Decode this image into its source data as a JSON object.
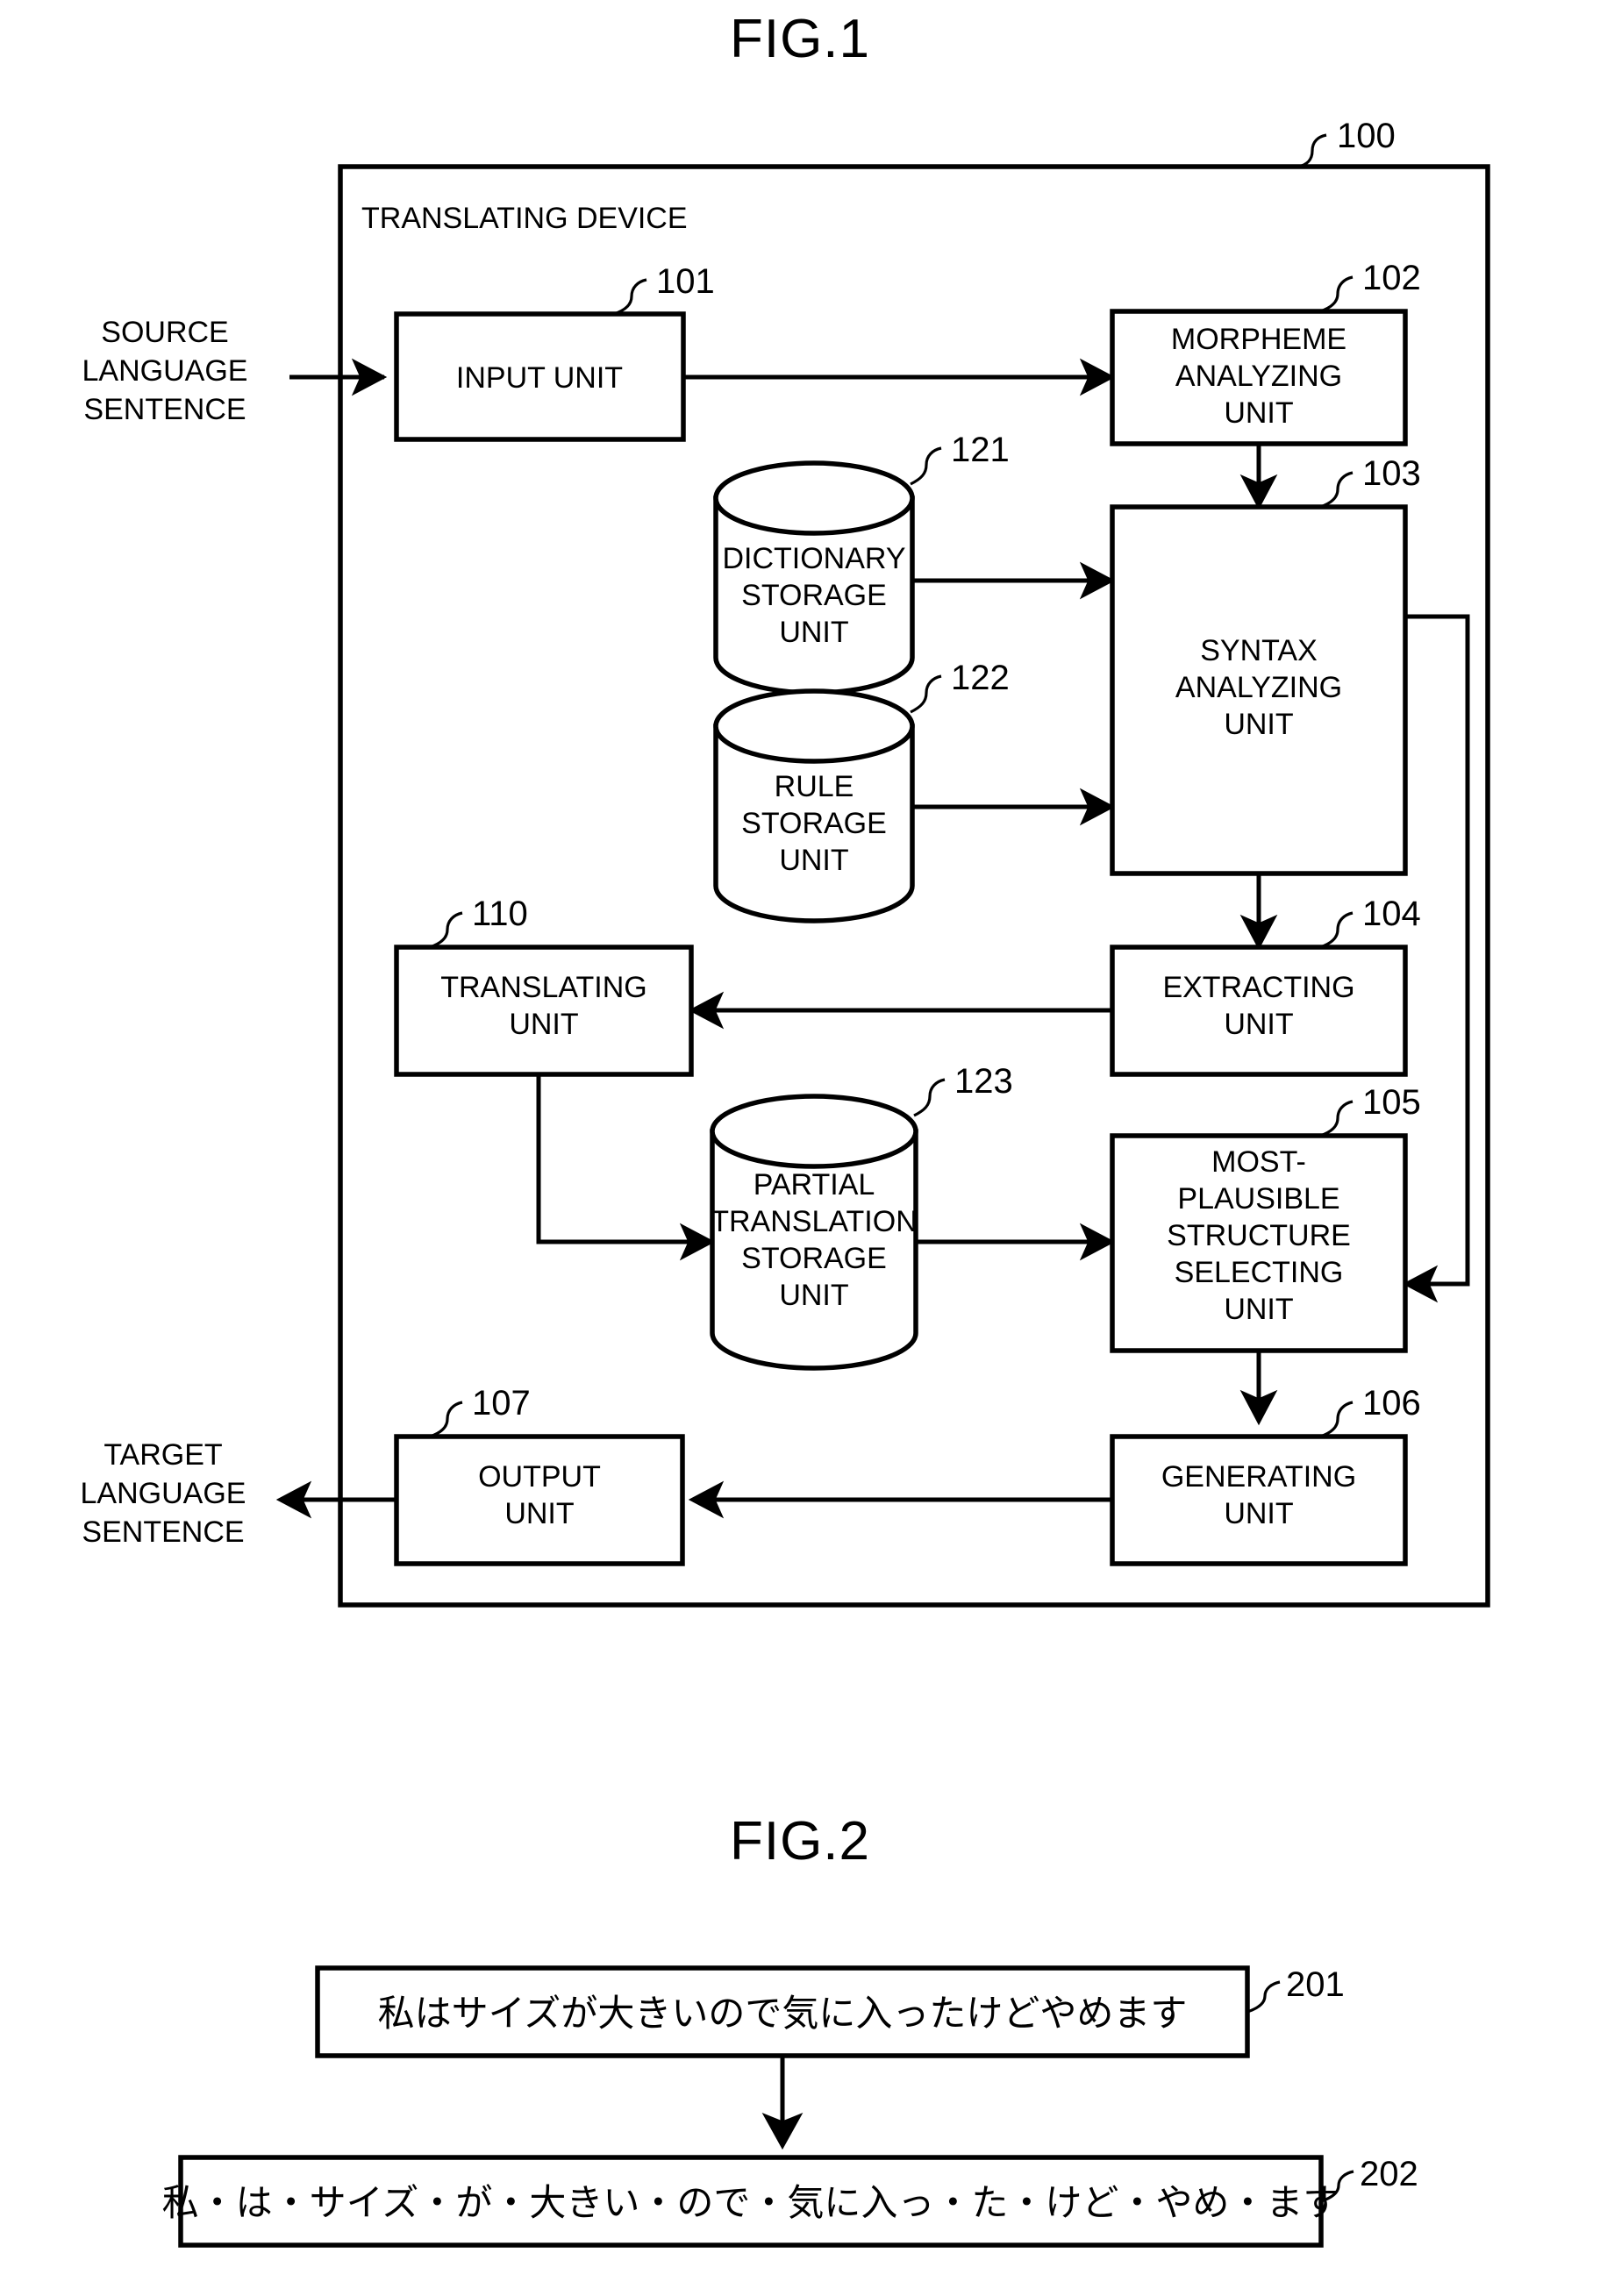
{
  "figures": [
    {
      "id": "fig1",
      "title": "FIG.1",
      "device": {
        "label": "TRANSLATING DEVICE",
        "ref": "100"
      },
      "external_labels": {
        "source": [
          "SOURCE",
          "LANGUAGE",
          "SENTENCE"
        ],
        "target": [
          "TARGET",
          "LANGUAGE",
          "SENTENCE"
        ]
      },
      "blocks": [
        {
          "name": "input-unit",
          "ref": "101",
          "lines": [
            "INPUT UNIT"
          ]
        },
        {
          "name": "morpheme-analyzing-unit",
          "ref": "102",
          "lines": [
            "MORPHEME",
            "ANALYZING",
            "UNIT"
          ]
        },
        {
          "name": "syntax-analyzing-unit",
          "ref": "103",
          "lines": [
            "SYNTAX",
            "ANALYZING",
            "UNIT"
          ]
        },
        {
          "name": "extracting-unit",
          "ref": "104",
          "lines": [
            "EXTRACTING",
            "UNIT"
          ]
        },
        {
          "name": "most-plausible-structure-selecting-unit",
          "ref": "105",
          "lines": [
            "MOST-",
            "PLAUSIBLE",
            "STRUCTURE",
            "SELECTING",
            "UNIT"
          ]
        },
        {
          "name": "generating-unit",
          "ref": "106",
          "lines": [
            "GENERATING",
            "UNIT"
          ]
        },
        {
          "name": "output-unit",
          "ref": "107",
          "lines": [
            "OUTPUT",
            "UNIT"
          ]
        },
        {
          "name": "translating-unit",
          "ref": "110",
          "lines": [
            "TRANSLATING",
            "UNIT"
          ]
        }
      ],
      "storages": [
        {
          "name": "dictionary-storage-unit",
          "ref": "121",
          "lines": [
            "DICTIONARY",
            "STORAGE",
            "UNIT"
          ]
        },
        {
          "name": "rule-storage-unit",
          "ref": "122",
          "lines": [
            "RULE",
            "STORAGE",
            "UNIT"
          ]
        },
        {
          "name": "partial-translation-storage-unit",
          "ref": "123",
          "lines": [
            "PARTIAL",
            "TRANSLATION",
            "STORAGE",
            "UNIT"
          ]
        }
      ]
    },
    {
      "id": "fig2",
      "title": "FIG.2",
      "boxes": [
        {
          "name": "source-sentence-box",
          "ref": "201",
          "text": "私はサイズが大きいので気に入ったけどやめます"
        },
        {
          "name": "segmented-sentence-box",
          "ref": "202",
          "text": "私・は・サイズ・が・大きい・ので・気に入っ・た・けど・やめ・ます"
        }
      ]
    }
  ],
  "colors": {
    "ink": "#000000",
    "paper": "#ffffff"
  }
}
